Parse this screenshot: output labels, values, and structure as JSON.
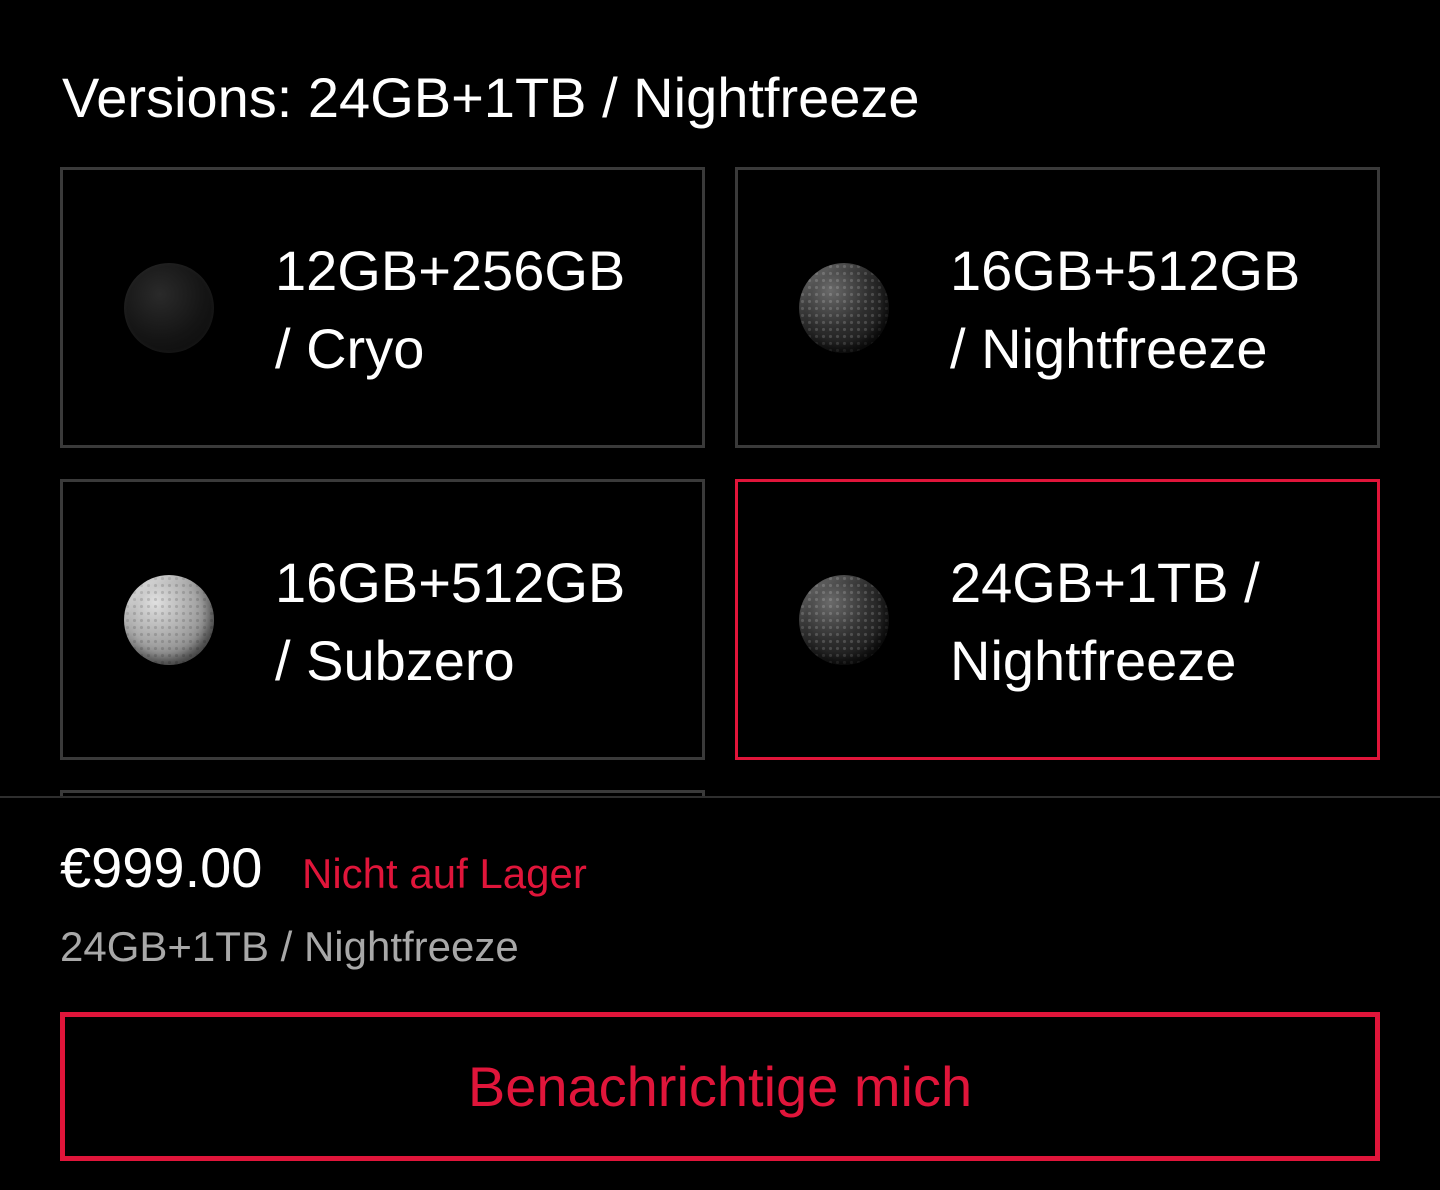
{
  "header": {
    "versions_title": "Versions: 24GB+1TB / Nightfreeze"
  },
  "versions": [
    {
      "line1": "12GB+256GB",
      "line2": "/ Cryo",
      "swatch": "solid-black",
      "selected": false
    },
    {
      "line1": "16GB+512GB",
      "line2": "/ Nightfreeze",
      "swatch": "textured-dark",
      "selected": false
    },
    {
      "line1": "16GB+512GB",
      "line2": "/ Subzero",
      "swatch": "textured-silver",
      "selected": false
    },
    {
      "line1": "24GB+1TB /",
      "line2": "Nightfreeze",
      "swatch": "textured-dark",
      "selected": true
    }
  ],
  "footer": {
    "price": "€999.00",
    "stock_status": "Nicht auf Lager",
    "selected_variant": "24GB+1TB / Nightfreeze",
    "notify_button": "Benachrichtige mich"
  },
  "colors": {
    "background": "#000000",
    "accent": "#e0153a",
    "card_border": "#3a3a3a",
    "secondary_text": "#a8a8a8"
  }
}
